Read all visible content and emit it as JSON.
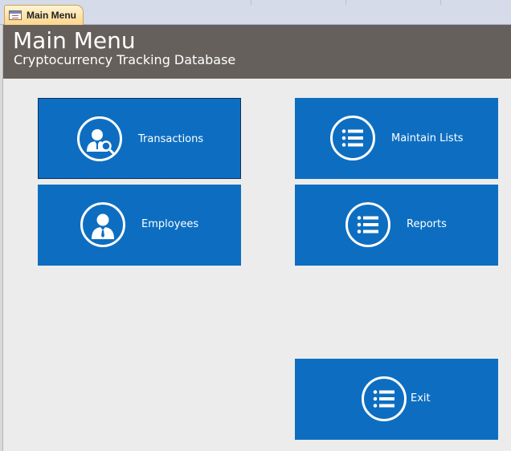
{
  "tab": {
    "label": "Main Menu",
    "icon": "form-icon"
  },
  "header": {
    "title": "Main Menu",
    "subtitle": "Cryptocurrency Tracking Database"
  },
  "buttons": {
    "transactions": {
      "label": "Transactions",
      "icon": "user-search-icon"
    },
    "employees": {
      "label": "Employees",
      "icon": "user-icon"
    },
    "maintain_lists": {
      "label": "Maintain Lists",
      "icon": "list-icon"
    },
    "reports": {
      "label": "Reports",
      "icon": "list-icon"
    },
    "exit": {
      "label": "Exit",
      "icon": "list-icon"
    }
  },
  "colors": {
    "header_bg": "#66605c",
    "button_bg": "#0d6ec1",
    "form_bg": "#ececec",
    "tab_bg": "#fbd58a"
  }
}
